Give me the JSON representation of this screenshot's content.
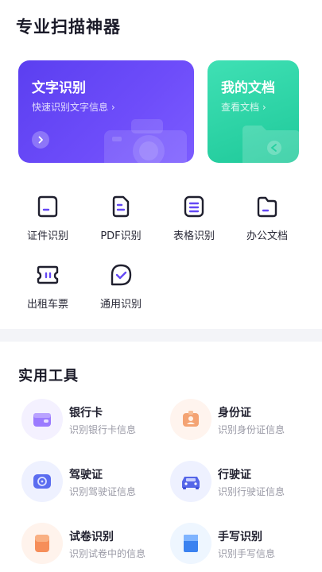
{
  "header": {
    "title": "专业扫描神器"
  },
  "cards": {
    "text_recognition": {
      "title": "文字识别",
      "subtitle": "快速识别文字信息 ›",
      "color": "#6448f5"
    },
    "my_docs": {
      "title": "我的文档",
      "subtitle": "查看文档 ›",
      "color": "#26cfa0"
    }
  },
  "features": [
    {
      "label": "证件识别",
      "icon": "id-card-icon"
    },
    {
      "label": "PDF识别",
      "icon": "pdf-doc-icon"
    },
    {
      "label": "表格识别",
      "icon": "table-icon"
    },
    {
      "label": "办公文档",
      "icon": "folder-icon"
    },
    {
      "label": "出租车票",
      "icon": "ticket-icon"
    },
    {
      "label": "通用识别",
      "icon": "check-chat-icon"
    }
  ],
  "tools_section": {
    "title": "实用工具",
    "items": [
      {
        "name": "银行卡",
        "desc": "识别银行卡信息",
        "icon": "wallet-icon",
        "bg": "#f4f1ff"
      },
      {
        "name": "身份证",
        "desc": "识别身份证信息",
        "icon": "id-badge-icon",
        "bg": "#fff4ee"
      },
      {
        "name": "驾驶证",
        "desc": "识别驾驶证信息",
        "icon": "steering-wheel-icon",
        "bg": "#eef1ff"
      },
      {
        "name": "行驶证",
        "desc": "识别行驶证信息",
        "icon": "car-icon",
        "bg": "#eef1ff"
      },
      {
        "name": "试卷识别",
        "desc": "识别试卷中的信息",
        "icon": "paper-icon",
        "bg": "#fff3ec"
      },
      {
        "name": "手写识别",
        "desc": "识别手写信息",
        "icon": "handwriting-icon",
        "bg": "#eef6ff"
      }
    ]
  }
}
